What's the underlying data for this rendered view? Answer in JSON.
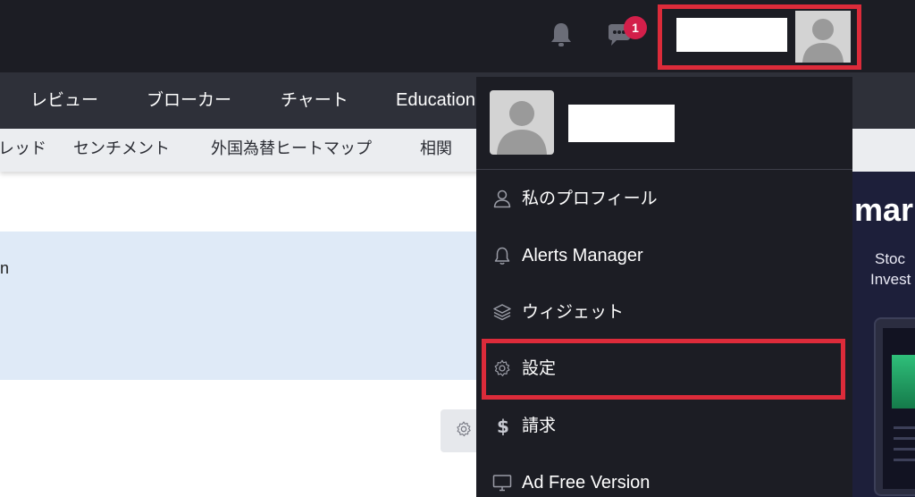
{
  "header": {
    "notification_badge": "1",
    "accent_color": "#dc2b3a",
    "badge_color": "#d31f4a"
  },
  "nav": {
    "items": [
      "レビュー",
      "ブローカー",
      "チャート",
      "Education"
    ]
  },
  "subnav": {
    "items": [
      "レッド",
      "センチメント",
      "外国為替ヒートマップ",
      "相関"
    ]
  },
  "content": {
    "info_text_fragment": "n"
  },
  "ad": {
    "brand": "mar",
    "line1": "Stoc",
    "line2": "Invest"
  },
  "user_menu": {
    "items": [
      {
        "label": "私のプロフィール",
        "icon": "user-icon"
      },
      {
        "label": "Alerts Manager",
        "icon": "bell-icon"
      },
      {
        "label": "ウィジェット",
        "icon": "layers-icon"
      },
      {
        "label": "設定",
        "icon": "gear-icon"
      },
      {
        "label": "請求",
        "icon": "dollar-icon"
      },
      {
        "label": "Ad Free Version",
        "icon": "monitor-icon"
      }
    ]
  }
}
